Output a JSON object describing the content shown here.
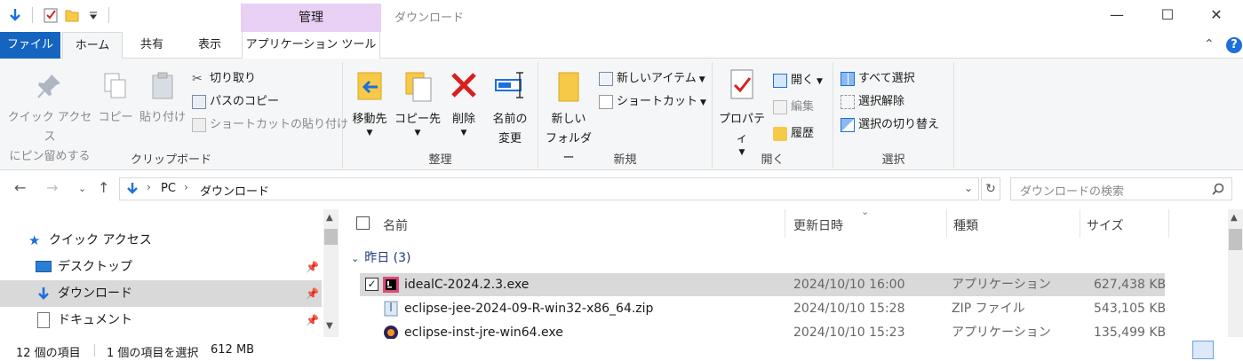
{
  "window": {
    "title": "ダウンロード",
    "context_group": "管理"
  },
  "qat": {
    "icons": [
      "down-arrow-icon",
      "properties-check-icon",
      "new-folder-icon",
      "customize-dropdown-icon"
    ]
  },
  "tabs": [
    {
      "label": "ファイル",
      "file": true
    },
    {
      "label": "ホーム",
      "selected": true
    },
    {
      "label": "共有"
    },
    {
      "label": "表示"
    },
    {
      "label": "アプリケーション ツール"
    }
  ],
  "ribbon": {
    "clipboard": {
      "label": "クリップボード",
      "pin_line1": "クイック アクセス",
      "pin_line2": "にピン留めする",
      "copy": "コピー",
      "paste": "貼り付け",
      "cut": "切り取り",
      "copy_path": "パスのコピー",
      "paste_shortcut": "ショートカットの貼り付け"
    },
    "organize": {
      "label": "整理",
      "move_to": "移動先",
      "copy_to": "コピー先",
      "delete": "削除",
      "rename_line1": "名前の",
      "rename_line2": "変更"
    },
    "new": {
      "label": "新規",
      "new_folder_line1": "新しい",
      "new_folder_line2": "フォルダー",
      "new_item": "新しいアイテム",
      "easy_access": "ショートカット"
    },
    "open": {
      "label": "開く",
      "properties": "プロパティ",
      "open": "開く",
      "edit": "編集",
      "history": "履歴"
    },
    "select": {
      "label": "選択",
      "select_all": "すべて選択",
      "select_none": "選択解除",
      "invert": "選択の切り替え"
    }
  },
  "address": {
    "segments": [
      "PC",
      "ダウンロード"
    ],
    "search_placeholder": "ダウンロードの検索"
  },
  "nav_pane": {
    "items": [
      {
        "label": "クイック アクセス",
        "icon": "star-icon"
      },
      {
        "label": "デスクトップ",
        "icon": "desktop-icon",
        "pinned": true
      },
      {
        "label": "ダウンロード",
        "icon": "download-folder-icon",
        "pinned": true,
        "selected": true
      },
      {
        "label": "ドキュメント",
        "icon": "document-icon",
        "pinned": true
      }
    ]
  },
  "list": {
    "columns": {
      "name": "名前",
      "date": "更新日時",
      "type": "種類",
      "size": "サイズ"
    },
    "group": "昨日 (3)",
    "files": [
      {
        "name": "idealC-2024.2.3.exe",
        "date": "2024/10/10 16:00",
        "type": "アプリケーション",
        "size": "627,438 KB",
        "selected": true
      },
      {
        "name": "eclipse-jee-2024-09-R-win32-x86_64.zip",
        "date": "2024/10/10 15:28",
        "type": "ZIP ファイル",
        "size": "543,105 KB"
      },
      {
        "name": "eclipse-inst-jre-win64.exe",
        "date": "2024/10/10 15:23",
        "type": "アプリケーション",
        "size": "135,499 KB"
      }
    ]
  },
  "status": {
    "item_count": "12 個の項目",
    "selected": "1 個の項目を選択",
    "size": "612 MB"
  },
  "colors": {
    "file_tab": "#1565c0",
    "context_group": "#e9d0f5",
    "selection": "#d9d9d9",
    "accent_blue": "#1e6fd9",
    "delete_red": "#d9201e"
  }
}
